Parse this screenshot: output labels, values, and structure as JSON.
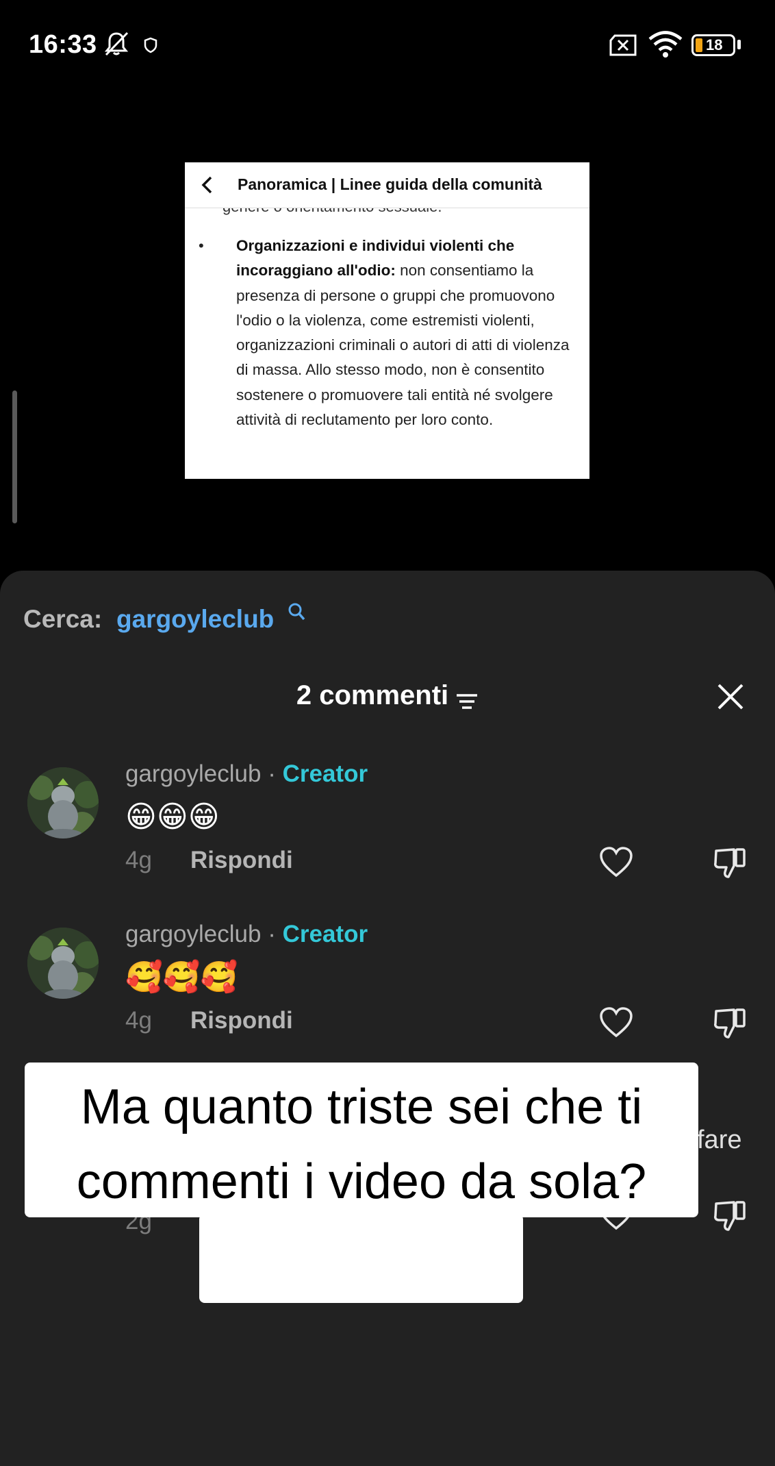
{
  "status_bar": {
    "time": "16:33",
    "battery": "18",
    "icons": [
      "bell-off-icon",
      "shield-icon",
      "sim-off-icon",
      "wifi-icon",
      "battery-icon"
    ]
  },
  "embedded_card": {
    "title": "Panoramica | Linee guida della comunità",
    "cut_text": "genere o orientamento sessuale.",
    "bullet_bold": "Organizzazioni e individui violenti che incoraggiano all'odio:",
    "bullet_text": " non consentiamo la presenza di persone o gruppi che promuovono l'odio o la violenza, come estremisti violenti, organizzazioni criminali o autori di atti di violenza di massa. Allo stesso modo, non è consentito sostenere o promuovere tali entità né svolgere attività di reclutamento per loro conto."
  },
  "comments_panel": {
    "search_label": "Cerca:",
    "search_query": "gargoyleclub",
    "count_label": "2 commenti",
    "comments": [
      {
        "username": "gargoyleclub",
        "separator": "·",
        "badge": "Creator",
        "text": "😁😁😁",
        "age": "4g",
        "reply": "Rispondi"
      },
      {
        "username": "gargoyleclub",
        "separator": "·",
        "badge": "Creator",
        "text": "🥰🥰🥰",
        "age": "4g",
        "reply": "Rispondi"
      }
    ],
    "hidden_comment_fragment": "fare",
    "hidden_comment_age": "2g"
  },
  "caption": {
    "line1": "Ma quanto triste sei che ti",
    "line2": "commenti i video da sola?",
    "emoji": "😂😂😂😂"
  },
  "colors": {
    "panel_bg": "#222222",
    "link_blue": "#5aa9ee",
    "creator_cyan": "#34c8d8"
  }
}
